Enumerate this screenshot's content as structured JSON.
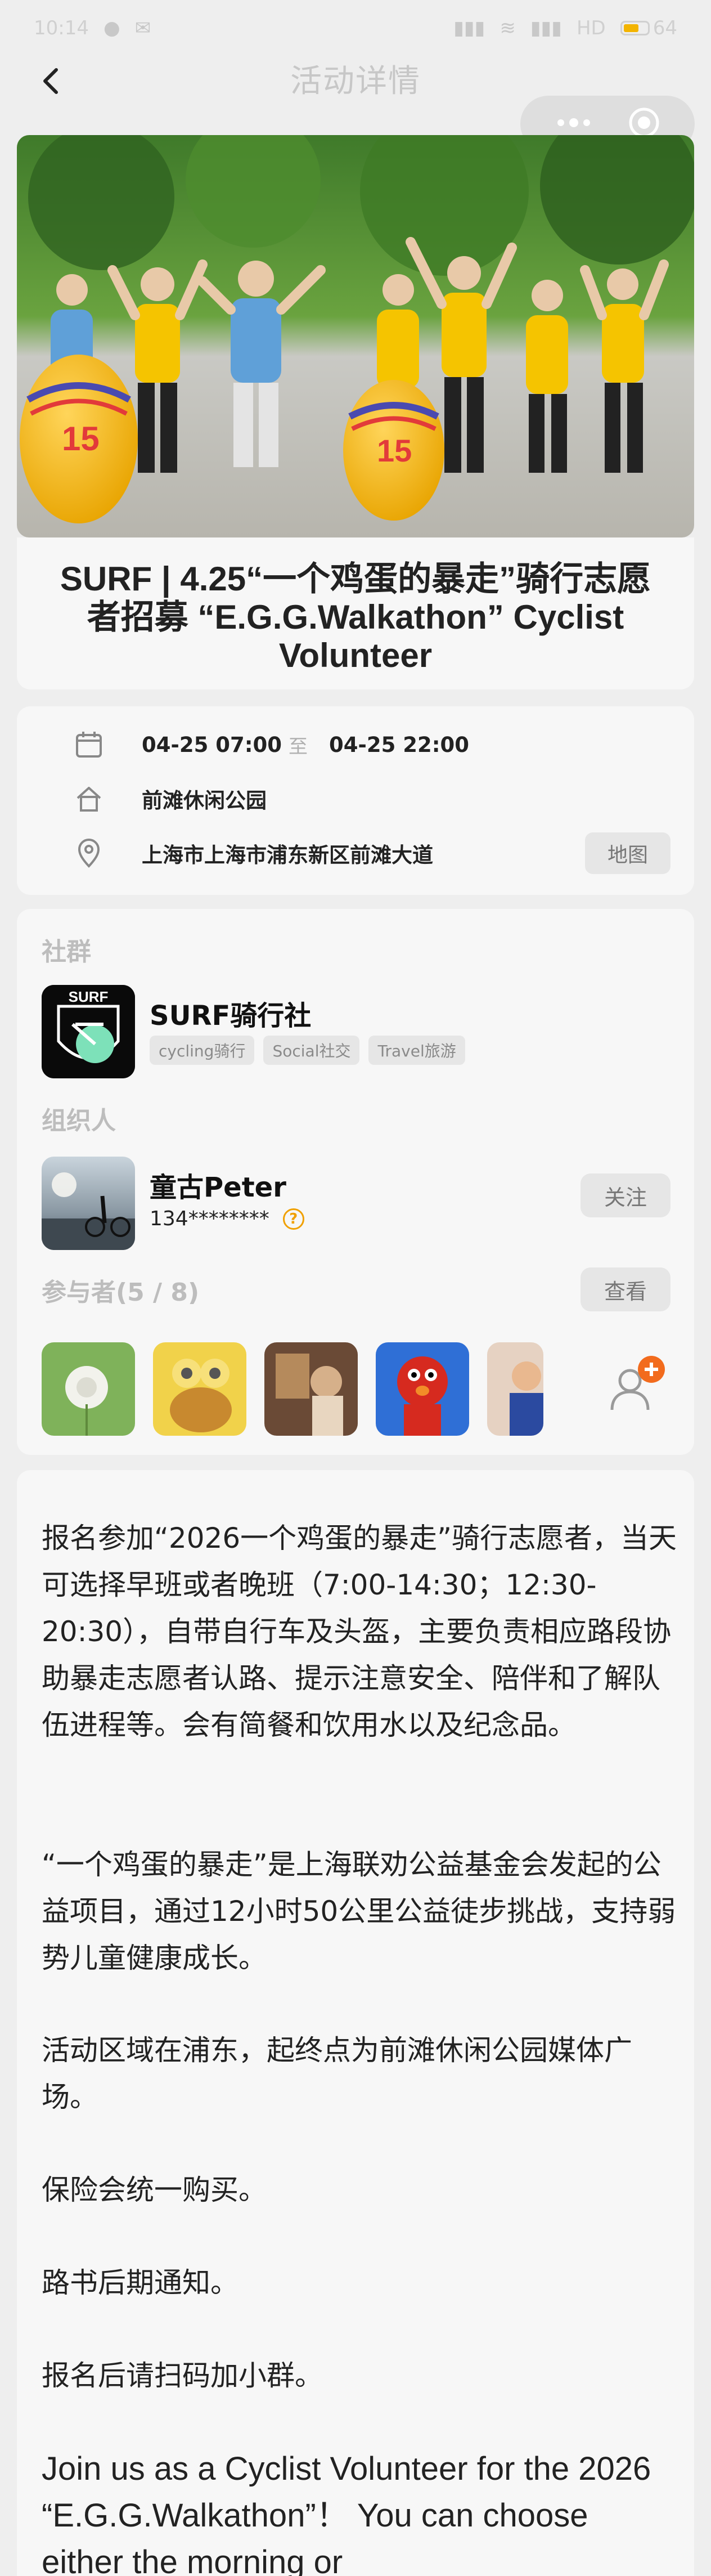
{
  "status_bar": {
    "time": "10:14",
    "network": "HD",
    "battery": "64",
    "battery_level": 0.64
  },
  "nav": {
    "title": "活动详情"
  },
  "event": {
    "title": "SURF | 4.25“一个鸡蛋的暴走”骑行志愿者招募 “E.G.G.Walkathon” Cyclist Volunteer"
  },
  "info": {
    "start_time": "04-25 07:00",
    "separator": "至",
    "end_time": "04-25 22:00",
    "venue": "前滩休闲公园",
    "address": "上海市上海市浦东新区前滩大道",
    "map_label": "地图"
  },
  "community": {
    "section_label": "社群",
    "name": "SURF骑行社",
    "tags": [
      "cycling骑行",
      "Social社交",
      "Travel旅游"
    ]
  },
  "organizer": {
    "section_label": "组织人",
    "name": "童古Peter",
    "phone": "134********",
    "follow_label": "关注"
  },
  "participants": {
    "section_label": "参与者(5 / 8)",
    "view_label": "查看"
  },
  "description": {
    "p1": "报名参加“2026一个鸡蛋的暴走”骑行志愿者，当天可选择早班或者晚班（7:00-14:30；12:30-20:30），自带自行车及头盔，主要负责相应路段协助暴走志愿者认路、提示注意安全、陪伴和了解队伍进程等。会有简餐和饮用水以及纪念品。",
    "p2": "“一个鸡蛋的暴走”是上海联劝公益基金会发起的公益项目，通过12小时50公里公益徒步挑战，支持弱势儿童健康成长。",
    "p3": "活动区域在浦东，起终点为前滩休闲公园媒体广场。",
    "p4": "保险会统一购买。",
    "p5": "路书后期通知。",
    "p6": "报名后请扫码加小群。",
    "p7": "Join us as a Cyclist Volunteer for the 2026 “E.G.G.Walkathon”！ You can choose either the morning or"
  },
  "colors": {
    "accent": "#f0a000",
    "badge": "#f26b1d",
    "background": "#eeeeee",
    "card": "#f7f7f7"
  }
}
